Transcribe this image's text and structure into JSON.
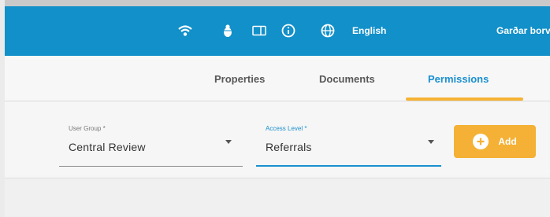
{
  "header": {
    "language": "English",
    "user_name": "Garðar borv"
  },
  "icons": {
    "wifi": "wifi-icon",
    "bug": "bug-icon",
    "tablet": "tablet-icon",
    "info": "info-icon",
    "globe": "globe-icon",
    "plus": "plus-circle-icon",
    "dropdown": "chevron-down-icon"
  },
  "tabs": [
    {
      "label": "Properties",
      "active": false
    },
    {
      "label": "Documents",
      "active": false
    },
    {
      "label": "Permissions",
      "active": true
    }
  ],
  "form": {
    "user_group": {
      "label": "User Group *",
      "value": "Central Review"
    },
    "access_level": {
      "label": "Access Level *",
      "value": "Referrals"
    },
    "add_label": "Add"
  },
  "colors": {
    "header_bg": "#1190c9",
    "active_tab": "#1a8fcf",
    "tab_underline": "#f5b233",
    "add_button": "#f5b135"
  }
}
